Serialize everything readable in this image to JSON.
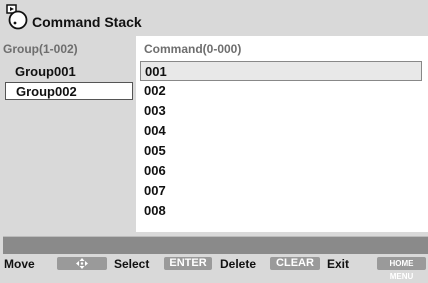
{
  "window": {
    "title": "Command Stack",
    "icon": "remote-control-icon"
  },
  "groups": {
    "header": "Group(1-002)",
    "items": [
      {
        "label": "Group001",
        "selected": false
      },
      {
        "label": "Group002",
        "selected": true
      }
    ]
  },
  "commands": {
    "header": "Command(0-000)",
    "items": [
      {
        "label": "001",
        "selected": true
      },
      {
        "label": "002",
        "selected": false
      },
      {
        "label": "003",
        "selected": false
      },
      {
        "label": "004",
        "selected": false
      },
      {
        "label": "005",
        "selected": false
      },
      {
        "label": "006",
        "selected": false
      },
      {
        "label": "007",
        "selected": false
      },
      {
        "label": "008",
        "selected": false
      }
    ]
  },
  "footer": {
    "move_label": "Move",
    "move_icon": "four-way-arrow-icon",
    "select_label": "Select",
    "enter_key": "ENTER",
    "delete_label": "Delete",
    "clear_key": "CLEAR",
    "exit_label": "Exit",
    "home_menu_key": "HOME MENU"
  },
  "colors": {
    "background": "#d9d9d9",
    "key_badge": "#9a9a9a",
    "status_bar": "#8a8a8a"
  }
}
